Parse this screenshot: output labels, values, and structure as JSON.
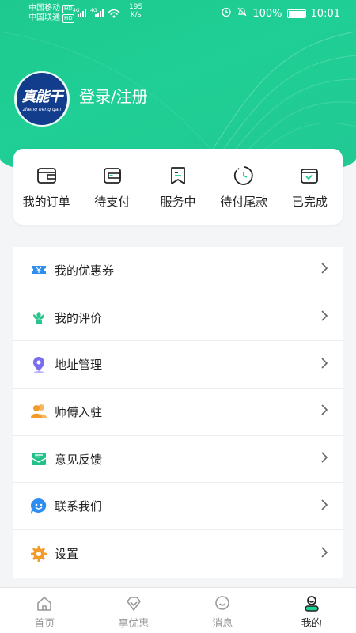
{
  "status_bar": {
    "carrier1": "中国移动",
    "carrier2": "中国联通",
    "hd": "HD",
    "net1": "4G",
    "net2": "4G",
    "speed_value": "195",
    "speed_unit": "K/s",
    "battery": "100%",
    "time": "10:01"
  },
  "profile": {
    "logo_text": "真能干",
    "logo_sub": "zheng neng gan",
    "login_label": "登录/注册"
  },
  "orders": [
    {
      "label": "我的订单",
      "icon": "wallet-icon"
    },
    {
      "label": "待支付",
      "icon": "card-icon"
    },
    {
      "label": "服务中",
      "icon": "bookmark-icon"
    },
    {
      "label": "待付尾款",
      "icon": "clock-icon"
    },
    {
      "label": "已完成",
      "icon": "check-box-icon"
    }
  ],
  "menu": [
    {
      "label": "我的优惠券",
      "icon": "coupon-icon",
      "color": "#2e8ef0"
    },
    {
      "label": "我的评价",
      "icon": "flower-icon",
      "color": "#27c48c"
    },
    {
      "label": "地址管理",
      "icon": "location-pin-icon",
      "color": "#7b6cf0"
    },
    {
      "label": "师傅入驻",
      "icon": "users-icon",
      "color": "#f39a2a"
    },
    {
      "label": "意见反馈",
      "icon": "feedback-mail-icon",
      "color": "#21c28a"
    },
    {
      "label": "联系我们",
      "icon": "chat-face-icon",
      "color": "#2e8ef0"
    },
    {
      "label": "设置",
      "icon": "gear-icon",
      "color": "#f39a2a"
    }
  ],
  "tabs": [
    {
      "label": "首页",
      "icon": "home-icon",
      "active": false
    },
    {
      "label": "享优惠",
      "icon": "diamond-icon",
      "active": false
    },
    {
      "label": "消息",
      "icon": "message-icon",
      "active": false
    },
    {
      "label": "我的",
      "icon": "user-icon",
      "active": true
    }
  ],
  "colors": {
    "brand_green": "#1fcf95",
    "logo_blue": "#123c8c",
    "tab_inactive": "#999999",
    "tab_active": "#222222"
  }
}
